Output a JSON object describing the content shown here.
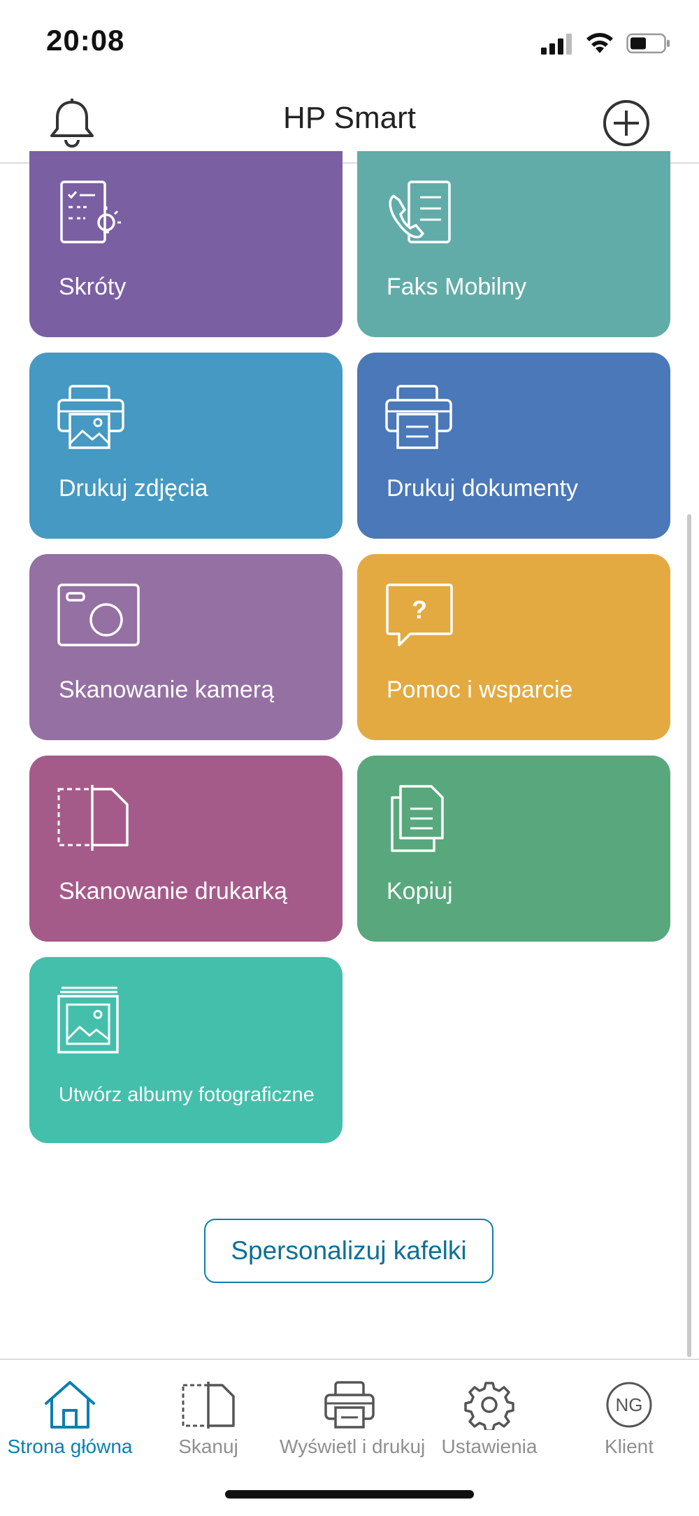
{
  "status": {
    "time": "20:08"
  },
  "header": {
    "title": "HP Smart"
  },
  "tiles": [
    {
      "label": "Skróty",
      "color": "#7a5fa3",
      "icon": "shortcuts-icon"
    },
    {
      "label": "Faks Mobilny",
      "color": "#61aca8",
      "icon": "mobile-fax-icon"
    },
    {
      "label": "Drukuj zdjęcia",
      "color": "#4599c2",
      "icon": "print-photos-icon"
    },
    {
      "label": "Drukuj dokumenty",
      "color": "#4a78b8",
      "icon": "print-documents-icon"
    },
    {
      "label": "Skanowanie kamerą",
      "color": "#9570a3",
      "icon": "camera-scan-icon"
    },
    {
      "label": "Pomoc i wsparcie",
      "color": "#e3aa42",
      "icon": "help-support-icon"
    },
    {
      "label": "Skanowanie drukarką",
      "color": "#a55b8a",
      "icon": "printer-scan-icon"
    },
    {
      "label": "Kopiuj",
      "color": "#59a87d",
      "icon": "copy-icon"
    },
    {
      "label": "Utwórz albumy fotograficzne",
      "color": "#43bfab",
      "icon": "photo-album-icon"
    }
  ],
  "personalize_button": "Spersonalizuj kafelki",
  "nav": [
    {
      "label": "Strona główna",
      "icon": "home-icon",
      "active": true
    },
    {
      "label": "Skanuj",
      "icon": "scan-icon",
      "active": false
    },
    {
      "label": "Wyświetl i drukuj",
      "icon": "print-icon",
      "active": false
    },
    {
      "label": "Ustawienia",
      "icon": "gear-icon",
      "active": false
    },
    {
      "label": "Klient",
      "icon": "account-icon",
      "initials": "NG",
      "active": false
    }
  ],
  "colors": {
    "accent": "#0b7fb0",
    "nav_inactive": "#8f8f8f"
  }
}
